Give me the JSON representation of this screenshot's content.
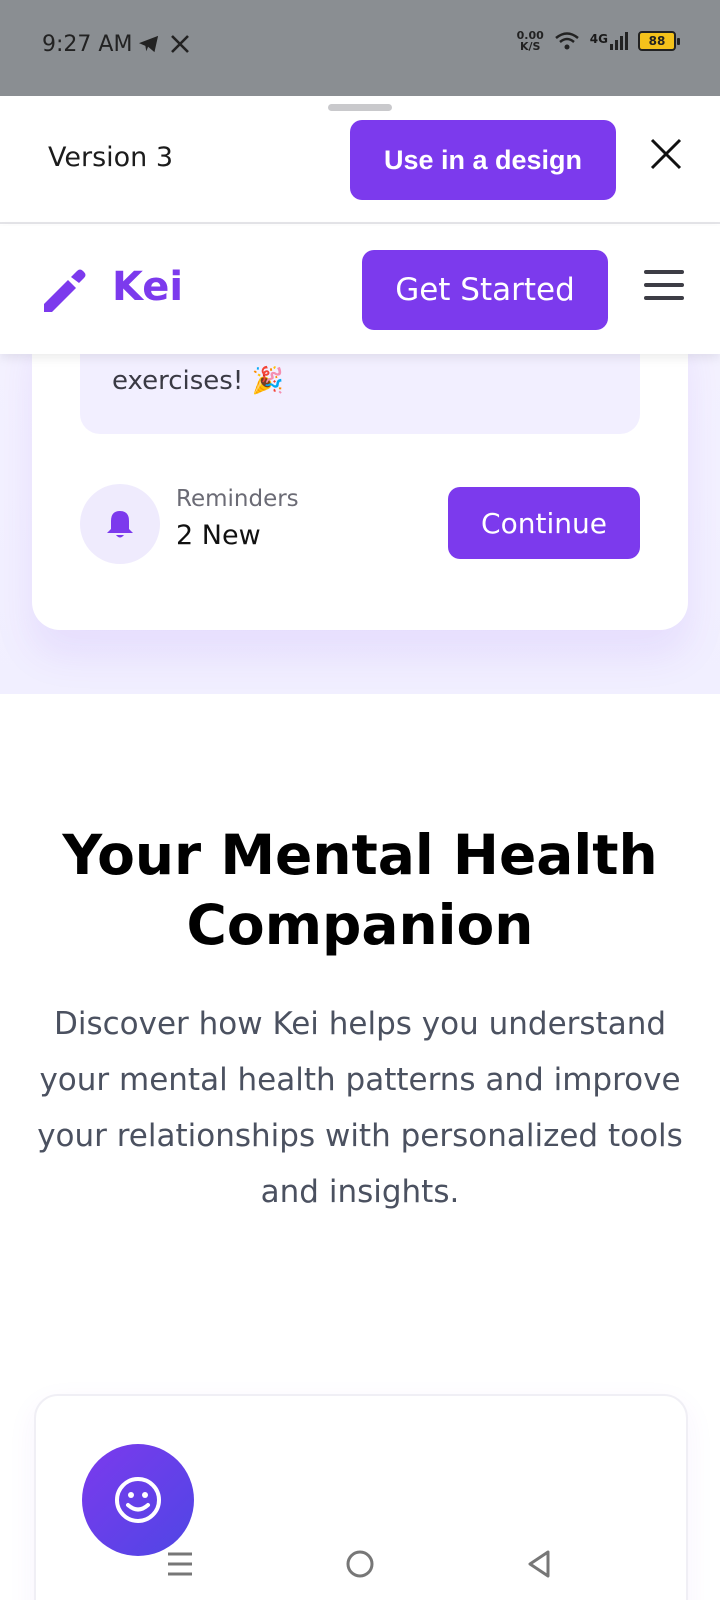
{
  "status_bar": {
    "time": "9:27 AM",
    "net_speed_value": "0.00",
    "net_speed_unit": "K/S",
    "network": "4G",
    "battery": "88",
    "icons": [
      "telegram-icon",
      "x-icon",
      "wifi-icon",
      "signal-icon",
      "battery-icon"
    ]
  },
  "sheet": {
    "version_label": "Version 3",
    "use_design_label": "Use in a design"
  },
  "navbar": {
    "brand": "Kei",
    "get_started_label": "Get Started"
  },
  "card": {
    "message_tail": "exercises! 🎉",
    "reminders_label": "Reminders",
    "reminders_count": "2 New",
    "continue_label": "Continue"
  },
  "content": {
    "headline": "Your Mental Health Companion",
    "subtext": "Discover how Kei helps you understand your mental health patterns and improve your relationships with personalized tools and insights."
  },
  "colors": {
    "accent": "#7c3aed",
    "accent_dark": "#4f46e5",
    "status_bar_bg": "#8a8e92"
  }
}
